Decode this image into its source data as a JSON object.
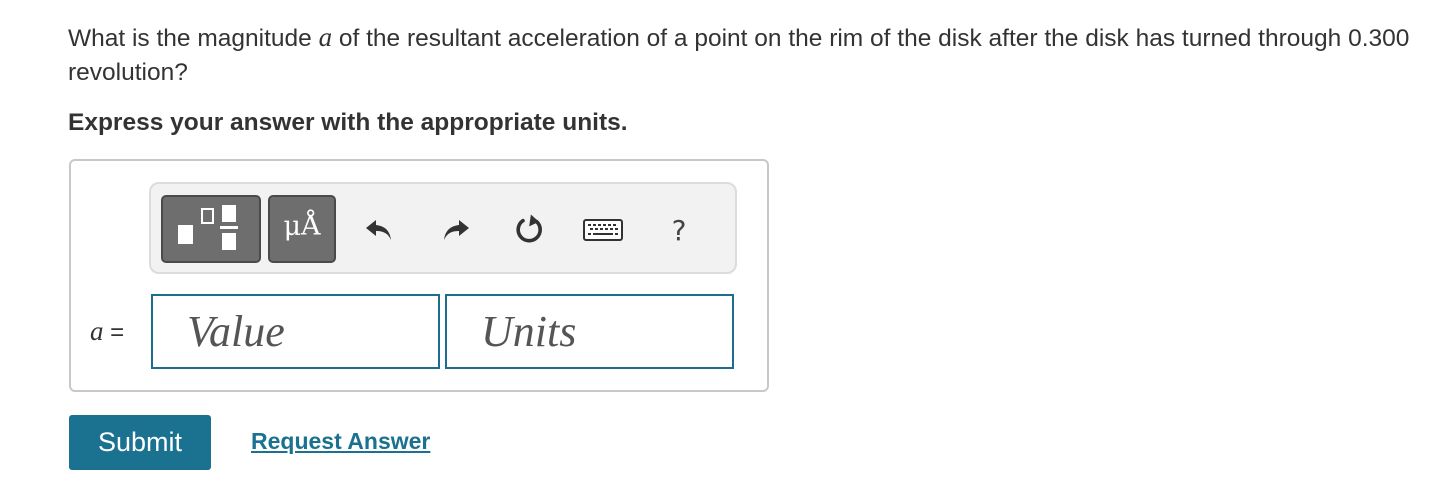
{
  "question": {
    "prefix": "What is the magnitude ",
    "variable": "a",
    "suffix": " of the resultant acceleration of a point on the rim of the disk after the disk has turned through 0.300 revolution?"
  },
  "instruction": "Express your answer with the appropriate units.",
  "toolbar": {
    "units_glyph": "μÅ",
    "help_label": "?",
    "icons": [
      "templates-icon",
      "units-icon",
      "undo-icon",
      "redo-icon",
      "reset-icon",
      "keyboard-icon",
      "help-icon"
    ]
  },
  "answer": {
    "variable": "a",
    "equals": "=",
    "value_placeholder": "Value",
    "units_placeholder": "Units"
  },
  "actions": {
    "submit_label": "Submit",
    "request_label": "Request Answer"
  },
  "colors": {
    "accent": "#1a7190",
    "field_border": "#1c6d8e",
    "toolbar_button": "#6e6e6e"
  }
}
